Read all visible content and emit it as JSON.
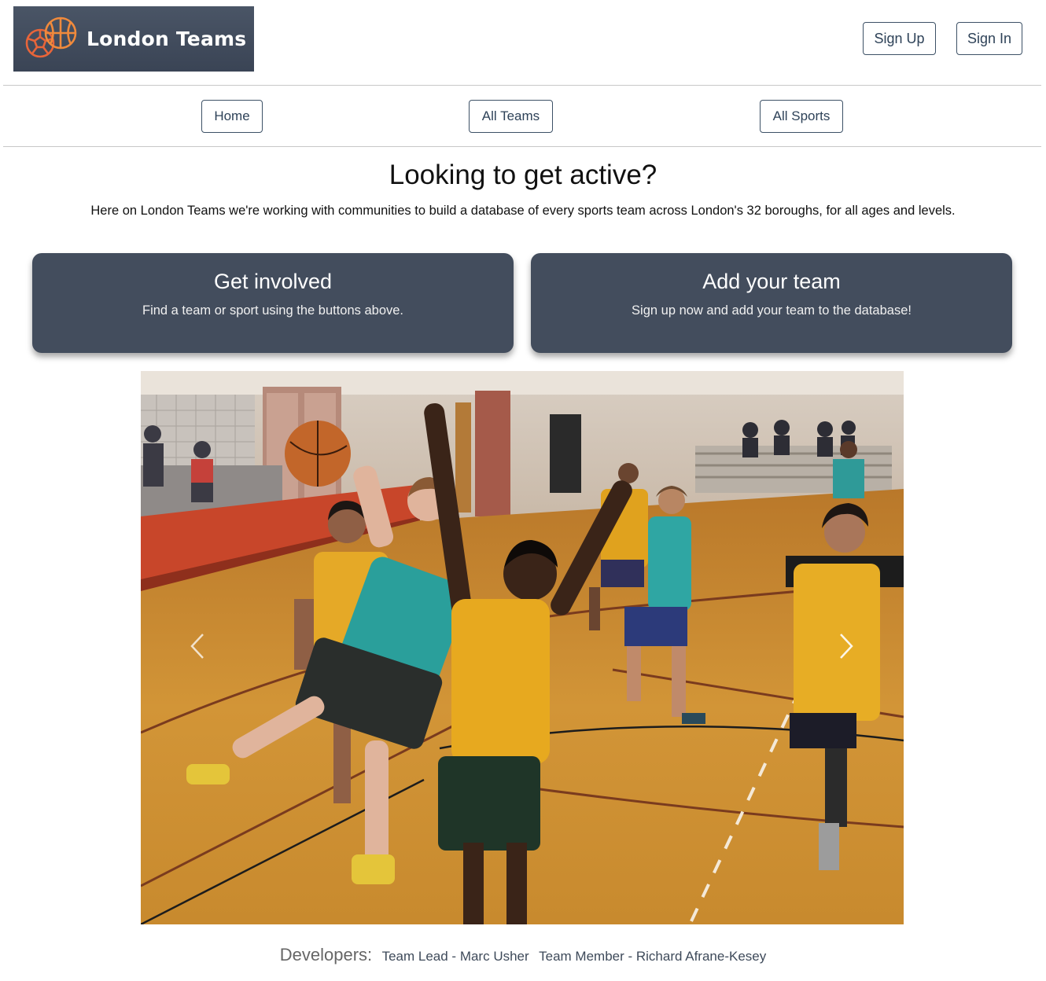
{
  "header": {
    "logo_text": "London Teams",
    "sign_up_label": "Sign Up",
    "sign_in_label": "Sign In"
  },
  "nav": {
    "home_label": "Home",
    "all_teams_label": "All Teams",
    "all_sports_label": "All Sports"
  },
  "hero": {
    "headline": "Looking to get active?",
    "intro": "Here on London Teams we're working with communities to build a database of every sports team across London's 32 boroughs, for all ages and levels."
  },
  "cards": [
    {
      "title": "Get involved",
      "subtitle": "Find a team or sport using the buttons above."
    },
    {
      "title": "Add your team",
      "subtitle": "Sign up now and add your team to the database!"
    }
  ],
  "carousel": {
    "prev_icon": "chevron-left-icon",
    "next_icon": "chevron-right-icon"
  },
  "footer": {
    "label": "Developers:",
    "developers": [
      "Team Lead - Marc Usher",
      "Team Member - Richard Afrane-Kesey"
    ]
  },
  "colors": {
    "logo_bg": "#434d5d",
    "card_bg": "#434d5d",
    "button_border": "#3d5166",
    "logo_accent": "#e8653a"
  }
}
